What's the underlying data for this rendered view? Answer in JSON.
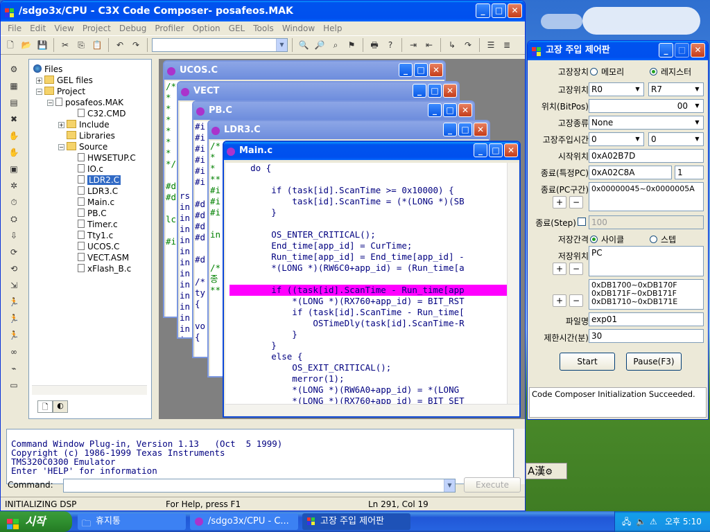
{
  "desktop": {
    "wallpaper": "bliss"
  },
  "main_window": {
    "title": "/sdgo3x/CPU - C3X Code Composer- posafeos.MAK",
    "menu": [
      "File",
      "Edit",
      "View",
      "Project",
      "Debug",
      "Profiler",
      "Option",
      "GEL",
      "Tools",
      "Window",
      "Help"
    ],
    "toolbar_combo_value": ""
  },
  "tree": {
    "root": "Files",
    "items": [
      {
        "label": "GEL files",
        "type": "folder"
      },
      {
        "label": "Project",
        "type": "folder"
      },
      {
        "label": "posafeos.MAK",
        "type": "project"
      },
      {
        "label": "C32.CMD",
        "type": "file"
      },
      {
        "label": "Include",
        "type": "folder"
      },
      {
        "label": "Libraries",
        "type": "folder"
      },
      {
        "label": "Source",
        "type": "folder"
      },
      {
        "label": "HWSETUP.C",
        "type": "file"
      },
      {
        "label": "IO.c",
        "type": "file"
      },
      {
        "label": "LDR2.C",
        "type": "file",
        "selected": true
      },
      {
        "label": "LDR3.C",
        "type": "file"
      },
      {
        "label": "Main.c",
        "type": "file"
      },
      {
        "label": "PB.C",
        "type": "file"
      },
      {
        "label": "Timer.c",
        "type": "file"
      },
      {
        "label": "Tty1.c",
        "type": "file"
      },
      {
        "label": "UCOS.C",
        "type": "file"
      },
      {
        "label": "VECT.ASM",
        "type": "file"
      },
      {
        "label": "xFlash_B.c",
        "type": "file"
      }
    ]
  },
  "editors": {
    "ucos": {
      "title": "UCOS.C",
      "lines": [
        "/**",
        "*",
        "*",
        "*",
        "*",
        "*",
        "*",
        "*/",
        "",
        "#d",
        "#d",
        "",
        "lc",
        "",
        "#i"
      ]
    },
    "vect": {
      "title": "VECT",
      "lines": [
        "",
        "",
        "",
        "",
        "",
        "",
        "",
        "",
        "rs",
        "in",
        "in",
        "in",
        "in",
        "in",
        "in",
        "in",
        "in",
        "in",
        "in",
        "in",
        "in",
        "in",
        "in",
        "in",
        "in"
      ]
    },
    "pb": {
      "title": "PB.C",
      "lines": [
        "#i",
        "#i",
        "#i",
        "#i",
        "#i",
        "#i",
        "",
        "#d",
        "#d",
        "#d",
        "#d",
        "",
        "#d",
        "",
        "/*",
        "ty",
        "{",
        "",
        "vo",
        "{"
      ]
    },
    "ldr3": {
      "title": "LDR3.C",
      "lines": [
        "/*",
        "*",
        "*",
        "**",
        "#i",
        "#i",
        "#i",
        "",
        "in",
        "",
        "",
        "/*",
        "종",
        "**"
      ]
    },
    "main": {
      "title": "Main.c",
      "lines": [
        "    do {",
        "",
        "        if (task[id].ScanTime >= 0x10000) {",
        "            task[id].ScanTime = (*(LONG *)(SB",
        "        }",
        "",
        "        OS_ENTER_CRITICAL();",
        "        End_time[app_id] = CurTime;",
        "        Run_time[app_id] = End_time[app_id] -",
        "        *(LONG *)(RW6C0+app_id) = (Run_time[a",
        "",
        "        if ((task[id].ScanTime - Run_time[app",
        "            *(LONG *)(RX760+app_id) = BIT_RST",
        "            if (task[id].ScanTime - Run_time[",
        "                OSTimeDly(task[id].ScanTime-R",
        "            }",
        "        }",
        "        else {",
        "            OS_EXIT_CRITICAL();",
        "            merror(1);",
        "            *(LONG *)(RW6A0+app_id) = *(LONG",
        "            *(LONG *)(RX760+app_id) = BIT_SET"
      ],
      "highlight_line": 11
    }
  },
  "command": {
    "output": "Command Window Plug-in, Version 1.13   (Oct  5 1999)\nCopyright (c) 1986-1999 Texas Instruments\nTMS320C0300 Emulator\nEnter 'HELP' for information",
    "label": "Command:",
    "input_value": "",
    "execute_label": "Execute"
  },
  "status": {
    "left": "INITIALIZING DSP",
    "help": "For Help, press F1",
    "pos": "Ln 291, Col 19"
  },
  "dialog": {
    "title": "고장 주입 제어판",
    "labels": {
      "device": "고장장치",
      "location": "고장위치",
      "bitpos": "위치(BitPos)",
      "type": "고장종류",
      "time": "고장주입시간",
      "start_pos": "시작위치",
      "end_pc": "종료(특정PC)",
      "end_range": "종료(PC구간)",
      "end_step": "종료(Step)",
      "interval": "저장간격",
      "save_loc": "저장위치",
      "filename": "파일명",
      "limit": "제한시간(분)"
    },
    "device_options": {
      "memory": "메모리",
      "register": "레지스터"
    },
    "loc_from": "R0",
    "loc_to": "R7",
    "bitpos": "00",
    "fault_type": "None",
    "time_a": "0",
    "time_b": "0",
    "start_pos": "0xA02B7D",
    "end_pc": "0xA02C8A",
    "end_pc_count": "1",
    "end_range": "0x00000045~0x0000005A",
    "end_step": "100",
    "interval_options": {
      "cycle": "사이클",
      "step": "스텝"
    },
    "save_loc": "PC",
    "save_ranges": [
      "0xDB1700~0xDB170F",
      "0xDB171F~0xDB171F",
      "0xDB1710~0xDB171E"
    ],
    "filename": "exp01",
    "limit": "30",
    "start_label": "Start",
    "pause_label": "Pause(F3)",
    "log": "Code Composer Initialization Succeeded."
  },
  "ime": {
    "text": "A漢"
  },
  "taskbar": {
    "start": "시작",
    "tasks": [
      "휴지통",
      "/sdgo3x/CPU - C...",
      "고장 주입 제어판"
    ],
    "clock": "오후 5:10"
  },
  "colors": {
    "xp_blue": "#0053ee",
    "highlight": "#ff00ff",
    "code": "#000080"
  }
}
